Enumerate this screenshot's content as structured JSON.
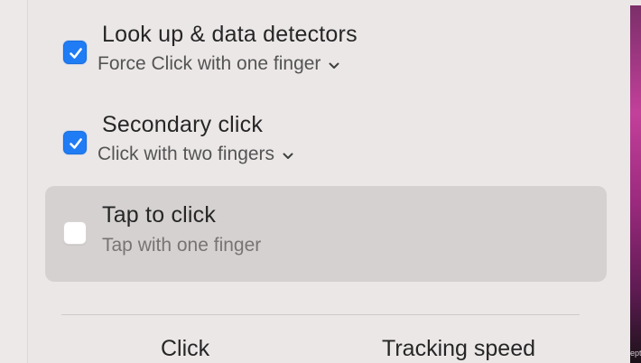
{
  "options": [
    {
      "title": "Look up & data detectors",
      "subtitle": "Force Click with one finger",
      "checked": true
    },
    {
      "title": "Secondary click",
      "subtitle": "Click with two fingers",
      "checked": true
    },
    {
      "title": "Tap to click",
      "subtitle": "Tap with one finger",
      "checked": false
    }
  ],
  "bottom": {
    "click_label": "Click",
    "tracking_label": "Tracking speed"
  },
  "desktop_peek_text": "ept",
  "colors": {
    "accent": "#1f7cf5",
    "highlight": "#d6d1d1",
    "panel": "#ece7e7"
  }
}
